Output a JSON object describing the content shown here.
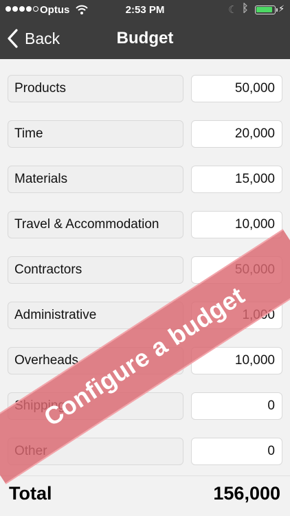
{
  "status_bar": {
    "carrier": "Optus",
    "time": "2:53 PM",
    "battery_level": 0.9,
    "battery_color": "#4cd964"
  },
  "nav": {
    "back_label": "Back",
    "title": "Budget"
  },
  "rows": [
    {
      "label": "Products",
      "value": "50,000"
    },
    {
      "label": "Time",
      "value": "20,000"
    },
    {
      "label": "Materials",
      "value": "15,000"
    },
    {
      "label": "Travel & Accommodation",
      "value": "10,000"
    },
    {
      "label": "Contractors",
      "value": "50,000"
    },
    {
      "label": "Administrative",
      "value": "1,000"
    },
    {
      "label": "Overheads",
      "value": "10,000"
    },
    {
      "label": "Shipping",
      "value": "0"
    },
    {
      "label": "Other",
      "value": "0"
    }
  ],
  "total": {
    "label": "Total",
    "value": "156,000"
  },
  "banner": {
    "text": "Configure a budget",
    "color": "#da6870"
  },
  "colors": {
    "header_bg": "#3d3d3d",
    "page_bg": "#f2f2f2"
  }
}
